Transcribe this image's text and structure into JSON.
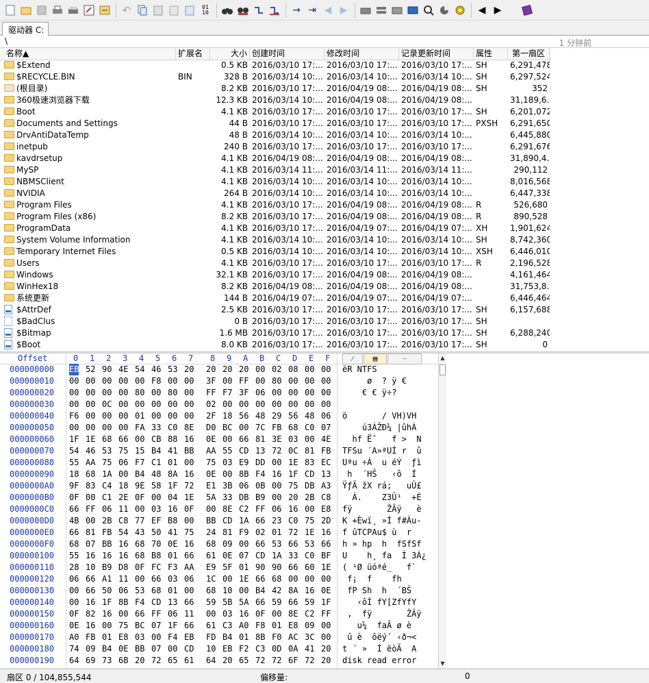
{
  "tab": {
    "label": "驱动器 C:"
  },
  "path": {
    "text": "\\",
    "updated": "1 分钟前"
  },
  "columns": {
    "name": "名称▲",
    "ext": "扩展名",
    "size": "大小",
    "created": "创建时间",
    "modified": "修改时间",
    "record": "记录更新时间",
    "attr": "属性",
    "sector": "第一扇区"
  },
  "files": [
    {
      "name": "$Extend",
      "ext": "",
      "size": "0.5 KB",
      "created": "2016/03/10  17:...",
      "modified": "2016/03/10  17:...",
      "record": "2016/03/10  17:...",
      "attr": "SH",
      "sector": "6,291,478",
      "icon": "folder"
    },
    {
      "name": "$RECYCLE.BIN",
      "ext": "BIN",
      "size": "328 B",
      "created": "2016/03/14  10:...",
      "modified": "2016/03/14  10:...",
      "record": "2016/03/14  10:...",
      "attr": "SH",
      "sector": "6,297,524",
      "icon": "folder"
    },
    {
      "name": "(根目录)",
      "ext": "",
      "size": "8.2 KB",
      "created": "2016/03/10  17:...",
      "modified": "2016/04/19  08:...",
      "record": "2016/04/19  08:...",
      "attr": "SH",
      "sector": "352",
      "icon": "root"
    },
    {
      "name": "360极速浏览器下载",
      "ext": "",
      "size": "12.3 KB",
      "created": "2016/03/14  10:...",
      "modified": "2016/04/19  08:...",
      "record": "2016/04/19  08:...",
      "attr": "",
      "sector": "31,189,6...",
      "icon": "folder"
    },
    {
      "name": "Boot",
      "ext": "",
      "size": "4.1 KB",
      "created": "2016/03/10  17:...",
      "modified": "2016/03/10  17:...",
      "record": "2016/03/10  17:...",
      "attr": "SH",
      "sector": "6,201,072",
      "icon": "folder"
    },
    {
      "name": "Documents and Settings",
      "ext": "",
      "size": "44 B",
      "created": "2016/03/10  17:...",
      "modified": "2016/03/10  17:...",
      "record": "2016/03/10  17:...",
      "attr": "PXSH",
      "sector": "6,291,650",
      "icon": "folder"
    },
    {
      "name": "DrvAntiDataTemp",
      "ext": "",
      "size": "48 B",
      "created": "2016/03/14  10:...",
      "modified": "2016/03/14  10:...",
      "record": "2016/03/14  10:...",
      "attr": "",
      "sector": "6,445,880",
      "icon": "folder"
    },
    {
      "name": "inetpub",
      "ext": "",
      "size": "240 B",
      "created": "2016/03/10  17:...",
      "modified": "2016/03/10  17:...",
      "record": "2016/03/10  17:...",
      "attr": "",
      "sector": "6,291,676",
      "icon": "folder"
    },
    {
      "name": "kavdrsetup",
      "ext": "",
      "size": "4.1 KB",
      "created": "2016/04/19  08:...",
      "modified": "2016/04/19  08:...",
      "record": "2016/04/19  08:...",
      "attr": "",
      "sector": "31,890,4...",
      "icon": "folder"
    },
    {
      "name": "MySP",
      "ext": "",
      "size": "4.1 KB",
      "created": "2016/03/14  11:...",
      "modified": "2016/03/14  11:...",
      "record": "2016/03/14  11:...",
      "attr": "",
      "sector": "290,112",
      "icon": "folder"
    },
    {
      "name": "NBMSClient",
      "ext": "",
      "size": "4.1 KB",
      "created": "2016/03/14  10:...",
      "modified": "2016/03/14  10:...",
      "record": "2016/03/14  10:...",
      "attr": "",
      "sector": "8,016,568",
      "icon": "folder"
    },
    {
      "name": "NVIDIA",
      "ext": "",
      "size": "264 B",
      "created": "2016/03/14  10:...",
      "modified": "2016/03/14  10:...",
      "record": "2016/03/14  10:...",
      "attr": "",
      "sector": "6,447,338",
      "icon": "folder"
    },
    {
      "name": "Program Files",
      "ext": "",
      "size": "4.1 KB",
      "created": "2016/03/10  17:...",
      "modified": "2016/04/19  08:...",
      "record": "2016/04/19  08:...",
      "attr": "R",
      "sector": "526,680",
      "icon": "folder"
    },
    {
      "name": "Program Files (x86)",
      "ext": "",
      "size": "8.2 KB",
      "created": "2016/03/10  17:...",
      "modified": "2016/04/19  08:...",
      "record": "2016/04/19  08:...",
      "attr": "R",
      "sector": "890,528",
      "icon": "folder"
    },
    {
      "name": "ProgramData",
      "ext": "",
      "size": "4.1 KB",
      "created": "2016/03/10  17:...",
      "modified": "2016/04/19  07:...",
      "record": "2016/04/19  07:...",
      "attr": "XH",
      "sector": "1,901,624",
      "icon": "folder"
    },
    {
      "name": "System Volume Information",
      "ext": "",
      "size": "4.1 KB",
      "created": "2016/03/14  10:...",
      "modified": "2016/03/14  10:...",
      "record": "2016/03/14  10:...",
      "attr": "SH",
      "sector": "8,742,360",
      "icon": "folder"
    },
    {
      "name": "Temporary Internet Files",
      "ext": "",
      "size": "0.5 KB",
      "created": "2016/03/14  10:...",
      "modified": "2016/03/14  10:...",
      "record": "2016/03/14  10:...",
      "attr": "XSH",
      "sector": "6,446,010",
      "icon": "folder"
    },
    {
      "name": "Users",
      "ext": "",
      "size": "4.1 KB",
      "created": "2016/03/10  17:...",
      "modified": "2016/03/10  17:...",
      "record": "2016/03/10  17:...",
      "attr": "R",
      "sector": "2,196,528",
      "icon": "folder"
    },
    {
      "name": "Windows",
      "ext": "",
      "size": "32.1 KB",
      "created": "2016/03/10  17:...",
      "modified": "2016/04/19  08:...",
      "record": "2016/04/19  08:...",
      "attr": "",
      "sector": "4,161,464",
      "icon": "folder"
    },
    {
      "name": "WinHex18",
      "ext": "",
      "size": "8.2 KB",
      "created": "2016/04/19  08:...",
      "modified": "2016/04/19  08:...",
      "record": "2016/04/19  08:...",
      "attr": "",
      "sector": "31,753,8...",
      "icon": "folder"
    },
    {
      "name": "系统更新",
      "ext": "",
      "size": "144 B",
      "created": "2016/04/19  07:...",
      "modified": "2016/04/19  07:...",
      "record": "2016/04/19  07:...",
      "attr": "",
      "sector": "6,446,464",
      "icon": "folder"
    },
    {
      "name": "$AttrDef",
      "ext": "",
      "size": "2.5 KB",
      "created": "2016/03/10  17:...",
      "modified": "2016/03/10  17:...",
      "record": "2016/03/10  17:...",
      "attr": "SH",
      "sector": "6,157,688",
      "icon": "file"
    },
    {
      "name": "$BadClus",
      "ext": "",
      "size": "0 B",
      "created": "2016/03/10  17:...",
      "modified": "2016/03/10  17:...",
      "record": "2016/03/10  17:...",
      "attr": "SH",
      "sector": "",
      "icon": "dots"
    },
    {
      "name": "$Bitmap",
      "ext": "",
      "size": "1.6 MB",
      "created": "2016/03/10  17:...",
      "modified": "2016/03/10  17:...",
      "record": "2016/03/10  17:...",
      "attr": "SH",
      "sector": "6,288,240",
      "icon": "file"
    },
    {
      "name": "$Boot",
      "ext": "",
      "size": "8.0 KB",
      "created": "2016/03/10  17:...",
      "modified": "2016/03/10  17:...",
      "record": "2016/03/10  17:...",
      "attr": "SH",
      "sector": "0",
      "icon": "file"
    }
  ],
  "hex": {
    "offset_label": "Offset",
    "col_labels": [
      "0",
      "1",
      "2",
      "3",
      "4",
      "5",
      "6",
      "7",
      "8",
      "9",
      "A",
      "B",
      "C",
      "D",
      "E",
      "F"
    ],
    "rows": [
      {
        "off": "000000000",
        "bytes": [
          "EB",
          "52",
          "90",
          "4E",
          "54",
          "46",
          "53",
          "20",
          "20",
          "20",
          "20",
          "00",
          "02",
          "08",
          "00",
          "00"
        ],
        "ascii": "ëR NTFS"
      },
      {
        "off": "000000010",
        "bytes": [
          "00",
          "00",
          "00",
          "00",
          "00",
          "F8",
          "00",
          "00",
          "3F",
          "00",
          "FF",
          "00",
          "80",
          "00",
          "00",
          "00"
        ],
        "ascii": "     ø  ? ÿ €"
      },
      {
        "off": "000000020",
        "bytes": [
          "00",
          "00",
          "00",
          "00",
          "80",
          "00",
          "80",
          "00",
          "FF",
          "F7",
          "3F",
          "06",
          "00",
          "00",
          "00",
          "00"
        ],
        "ascii": "    € € ÿ÷?"
      },
      {
        "off": "000000030",
        "bytes": [
          "00",
          "00",
          "0C",
          "00",
          "00",
          "00",
          "00",
          "00",
          "02",
          "00",
          "00",
          "00",
          "00",
          "00",
          "00",
          "00"
        ],
        "ascii": ""
      },
      {
        "off": "000000040",
        "bytes": [
          "F6",
          "00",
          "00",
          "00",
          "01",
          "00",
          "00",
          "00",
          "2F",
          "18",
          "56",
          "48",
          "29",
          "56",
          "48",
          "06"
        ],
        "ascii": "ö       / VH)VH"
      },
      {
        "off": "000000050",
        "bytes": [
          "00",
          "00",
          "00",
          "00",
          "FA",
          "33",
          "C0",
          "8E",
          "D0",
          "BC",
          "00",
          "7C",
          "FB",
          "68",
          "C0",
          "07"
        ],
        "ascii": "    ú3ÀŽÐ¼ |ûhÀ"
      },
      {
        "off": "000000060",
        "bytes": [
          "1F",
          "1E",
          "68",
          "66",
          "00",
          "CB",
          "88",
          "16",
          "0E",
          "00",
          "66",
          "81",
          "3E",
          "03",
          "00",
          "4E"
        ],
        "ascii": "  hf Ëˆ   f >  N"
      },
      {
        "off": "000000070",
        "bytes": [
          "54",
          "46",
          "53",
          "75",
          "15",
          "B4",
          "41",
          "BB",
          "AA",
          "55",
          "CD",
          "13",
          "72",
          "0C",
          "81",
          "FB"
        ],
        "ascii": "TFSu ´A»ªUÍ r  û"
      },
      {
        "off": "000000080",
        "bytes": [
          "55",
          "AA",
          "75",
          "06",
          "F7",
          "C1",
          "01",
          "00",
          "75",
          "03",
          "E9",
          "DD",
          "00",
          "1E",
          "83",
          "EC"
        ],
        "ascii": "Uªu ÷Á  u éÝ  ƒì"
      },
      {
        "off": "000000090",
        "bytes": [
          "18",
          "68",
          "1A",
          "00",
          "B4",
          "48",
          "8A",
          "16",
          "0E",
          "00",
          "8B",
          "F4",
          "16",
          "1F",
          "CD",
          "13"
        ],
        "ascii": " h  ´HŠ   ‹ô  Í"
      },
      {
        "off": "0000000A0",
        "bytes": [
          "9F",
          "83",
          "C4",
          "18",
          "9E",
          "58",
          "1F",
          "72",
          "E1",
          "3B",
          "06",
          "0B",
          "00",
          "75",
          "DB",
          "A3"
        ],
        "ascii": "ŸƒÄ žX rá;   uÛ£"
      },
      {
        "off": "0000000B0",
        "bytes": [
          "0F",
          "00",
          "C1",
          "2E",
          "0F",
          "00",
          "04",
          "1E",
          "5A",
          "33",
          "DB",
          "B9",
          "00",
          "20",
          "2B",
          "C8"
        ],
        "ascii": "  Á.    Z3Û¹  +È"
      },
      {
        "off": "0000000C0",
        "bytes": [
          "66",
          "FF",
          "06",
          "11",
          "00",
          "03",
          "16",
          "0F",
          "00",
          "8E",
          "C2",
          "FF",
          "06",
          "16",
          "00",
          "E8"
        ],
        "ascii": "fÿ       ŽÂÿ   è"
      },
      {
        "off": "0000000D0",
        "bytes": [
          "4B",
          "00",
          "2B",
          "C8",
          "77",
          "EF",
          "B8",
          "00",
          "BB",
          "CD",
          "1A",
          "66",
          "23",
          "C0",
          "75",
          "2D"
        ],
        "ascii": "K +Èwï¸ »Í f#Àu-"
      },
      {
        "off": "0000000E0",
        "bytes": [
          "66",
          "81",
          "FB",
          "54",
          "43",
          "50",
          "41",
          "75",
          "24",
          "81",
          "F9",
          "02",
          "01",
          "72",
          "1E",
          "16"
        ],
        "ascii": "f ûTCPAu$ ù  r"
      },
      {
        "off": "0000000F0",
        "bytes": [
          "68",
          "07",
          "BB",
          "16",
          "68",
          "70",
          "0E",
          "16",
          "68",
          "09",
          "00",
          "66",
          "53",
          "66",
          "53",
          "66"
        ],
        "ascii": "h » hp  h  fSfSf"
      },
      {
        "off": "000000100",
        "bytes": [
          "55",
          "16",
          "16",
          "16",
          "68",
          "B8",
          "01",
          "66",
          "61",
          "0E",
          "07",
          "CD",
          "1A",
          "33",
          "C0",
          "BF"
        ],
        "ascii": "U    h¸ fa  Í 3À¿"
      },
      {
        "off": "000000110",
        "bytes": [
          "28",
          "10",
          "B9",
          "D8",
          "0F",
          "FC",
          "F3",
          "AA",
          "E9",
          "5F",
          "01",
          "90",
          "90",
          "66",
          "60",
          "1E"
        ],
        "ascii": "( ¹Ø üóªé_   f`"
      },
      {
        "off": "000000120",
        "bytes": [
          "06",
          "66",
          "A1",
          "11",
          "00",
          "66",
          "03",
          "06",
          "1C",
          "00",
          "1E",
          "66",
          "68",
          "00",
          "00",
          "00"
        ],
        "ascii": " f¡  f    fh"
      },
      {
        "off": "000000130",
        "bytes": [
          "00",
          "66",
          "50",
          "06",
          "53",
          "68",
          "01",
          "00",
          "68",
          "10",
          "00",
          "B4",
          "42",
          "8A",
          "16",
          "0E"
        ],
        "ascii": " fP Sh  h  ´BŠ"
      },
      {
        "off": "000000140",
        "bytes": [
          "00",
          "16",
          "1F",
          "8B",
          "F4",
          "CD",
          "13",
          "66",
          "59",
          "5B",
          "5A",
          "66",
          "59",
          "66",
          "59",
          "1F"
        ],
        "ascii": "   ‹ôÍ fY[ZfYfY"
      },
      {
        "off": "000000150",
        "bytes": [
          "0F",
          "82",
          "16",
          "00",
          "66",
          "FF",
          "06",
          "11",
          "00",
          "03",
          "16",
          "0F",
          "00",
          "8E",
          "C2",
          "FF"
        ],
        "ascii": " ‚  fÿ       ŽÂÿ"
      },
      {
        "off": "000000160",
        "bytes": [
          "0E",
          "16",
          "00",
          "75",
          "BC",
          "07",
          "1F",
          "66",
          "61",
          "C3",
          "A0",
          "F8",
          "01",
          "E8",
          "09",
          "00"
        ],
        "ascii": "   u¼  faÃ ø è"
      },
      {
        "off": "000000170",
        "bytes": [
          "A0",
          "FB",
          "01",
          "E8",
          "03",
          "00",
          "F4",
          "EB",
          "FD",
          "B4",
          "01",
          "8B",
          "F0",
          "AC",
          "3C",
          "00"
        ],
        "ascii": " û è  ôëý´ ‹ð¬<"
      },
      {
        "off": "000000180",
        "bytes": [
          "74",
          "09",
          "B4",
          "0E",
          "BB",
          "07",
          "00",
          "CD",
          "10",
          "EB",
          "F2",
          "C3",
          "0D",
          "0A",
          "41",
          "20"
        ],
        "ascii": "t ´ »  Í ëòÃ  A"
      },
      {
        "off": "000000190",
        "bytes": [
          "64",
          "69",
          "73",
          "6B",
          "20",
          "72",
          "65",
          "61",
          "64",
          "20",
          "65",
          "72",
          "72",
          "6F",
          "72",
          "20"
        ],
        "ascii": "disk read error"
      }
    ]
  },
  "status": {
    "sector": "扇区 0 / 104,855,544",
    "offset_label": "偏移量:",
    "offset_value": "0"
  },
  "toolbar_icons": [
    "new-file-icon",
    "open-folder-icon",
    "save-icon",
    "print-icon",
    "properties-icon",
    "edit-icon",
    "undo-icon",
    "copy-icon",
    "paste-icon",
    "clone-icon",
    "write-icon",
    "binary-icon",
    "find-icon",
    "find-hex-icon",
    "replace-icon",
    "replace-hex-icon",
    "goto-offset-icon",
    "goto-sector-icon",
    "back-icon",
    "forward-icon",
    "disk-icon",
    "ram-icon",
    "gear-icon",
    "calculator-icon",
    "magnify-icon",
    "chart-icon",
    "settings-icon",
    "prev-icon",
    "next-icon",
    "help-book-icon"
  ]
}
